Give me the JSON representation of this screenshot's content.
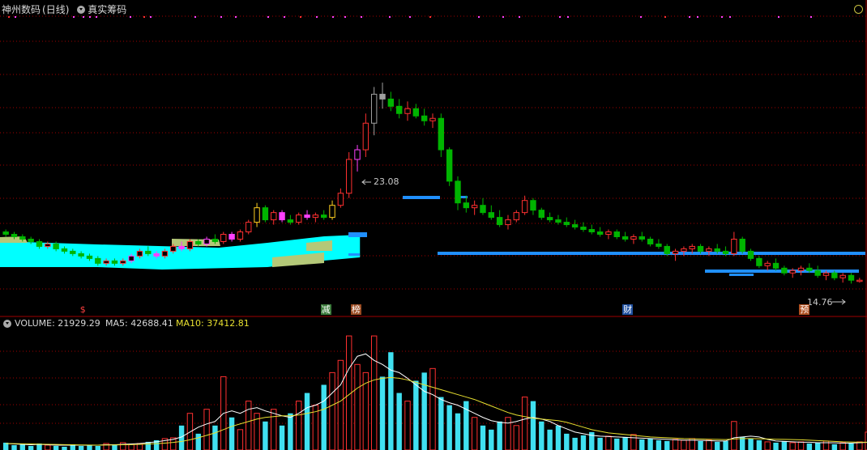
{
  "header": {
    "stock_name": "神州数码",
    "period": "(日线)",
    "indicator_name": "真实筹码"
  },
  "volume_panel": {
    "label": "VOLUME:",
    "volume_value": "21929.29",
    "ma5_label": "MA5:",
    "ma5_value": "42688.41",
    "ma10_label": "MA10:",
    "ma10_value": "37412.81"
  },
  "annotations": {
    "high_price": "23.08",
    "low_price": "14.76",
    "events": [
      {
        "text": "$",
        "color": "#ff4040",
        "bg": "#000000",
        "pos": 0.09
      },
      {
        "text": "减",
        "color": "#ffffff",
        "bg": "#3a7a3a",
        "pos": 0.37
      },
      {
        "text": "榜",
        "color": "#ffffff",
        "bg": "#9a4a20",
        "pos": 0.405
      },
      {
        "text": "财",
        "color": "#ffffff",
        "bg": "#2050a0",
        "pos": 0.72
      },
      {
        "text": "预",
        "color": "#ffffff",
        "bg": "#b05020",
        "pos": 0.925
      }
    ]
  },
  "colors": {
    "up": "#ff3030",
    "down": "#00b400",
    "cyan_band": "#00ffff",
    "khaki_band": "#b4c878",
    "blue_chips": "#2090ff",
    "magenta": "#ff40ff",
    "yellow_ma": "#e8e030",
    "white_ma": "#ffffff",
    "vol_down": "#40e0f0",
    "grid": "#a00000"
  },
  "chart_data": {
    "type": "candlestick",
    "title": "神州数码 (日线)",
    "ylim": [
      13.5,
      26.5
    ],
    "price_candles": [
      [
        16.9,
        17.0,
        16.7,
        16.8
      ],
      [
        16.8,
        16.9,
        16.6,
        16.7
      ],
      [
        16.7,
        16.8,
        16.5,
        16.6
      ],
      [
        16.6,
        16.7,
        16.4,
        16.5
      ],
      [
        16.5,
        16.6,
        16.2,
        16.3
      ],
      [
        16.3,
        16.5,
        16.2,
        16.4
      ],
      [
        16.4,
        16.5,
        16.1,
        16.2
      ],
      [
        16.2,
        16.3,
        16.0,
        16.1
      ],
      [
        16.1,
        16.2,
        15.9,
        16.0
      ],
      [
        16.0,
        16.1,
        15.8,
        15.9
      ],
      [
        15.9,
        16.0,
        15.7,
        15.8
      ],
      [
        15.8,
        15.9,
        15.5,
        15.6
      ],
      [
        15.6,
        15.8,
        15.5,
        15.7
      ],
      [
        15.7,
        15.8,
        15.5,
        15.6
      ],
      [
        15.6,
        15.8,
        15.5,
        15.7
      ],
      [
        15.7,
        16.0,
        15.6,
        15.9
      ],
      [
        15.9,
        16.2,
        15.8,
        16.1
      ],
      [
        16.1,
        16.3,
        15.9,
        16.0
      ],
      [
        16.0,
        16.1,
        15.8,
        15.9
      ],
      [
        15.9,
        16.2,
        15.8,
        16.1
      ],
      [
        16.1,
        16.4,
        16.0,
        16.3
      ],
      [
        16.3,
        16.5,
        16.1,
        16.2
      ],
      [
        16.2,
        16.6,
        16.1,
        16.5
      ],
      [
        16.5,
        16.6,
        16.3,
        16.4
      ],
      [
        16.4,
        16.7,
        16.3,
        16.6
      ],
      [
        16.6,
        16.8,
        16.4,
        16.5
      ],
      [
        16.5,
        16.9,
        16.4,
        16.8
      ],
      [
        16.8,
        16.9,
        16.5,
        16.6
      ],
      [
        16.6,
        17.0,
        16.5,
        16.9
      ],
      [
        16.9,
        17.4,
        16.8,
        17.3
      ],
      [
        17.3,
        18.1,
        17.1,
        17.9
      ],
      [
        17.9,
        18.0,
        17.3,
        17.4
      ],
      [
        17.4,
        17.8,
        17.2,
        17.7
      ],
      [
        17.7,
        17.8,
        17.3,
        17.4
      ],
      [
        17.4,
        17.6,
        17.2,
        17.3
      ],
      [
        17.3,
        17.7,
        17.2,
        17.6
      ],
      [
        17.6,
        17.8,
        17.4,
        17.5
      ],
      [
        17.5,
        17.7,
        17.3,
        17.6
      ],
      [
        17.6,
        17.8,
        17.4,
        17.5
      ],
      [
        17.5,
        18.2,
        17.4,
        18.0
      ],
      [
        18.0,
        18.7,
        17.9,
        18.5
      ],
      [
        18.5,
        20.2,
        18.3,
        19.9
      ],
      [
        19.9,
        20.5,
        19.4,
        20.3
      ],
      [
        20.3,
        21.8,
        20.0,
        21.4
      ],
      [
        21.4,
        22.9,
        20.9,
        22.6
      ],
      [
        22.6,
        23.08,
        22.0,
        22.4
      ],
      [
        22.4,
        22.7,
        21.9,
        22.1
      ],
      [
        22.1,
        22.4,
        21.6,
        21.8
      ],
      [
        21.8,
        22.3,
        21.5,
        22.0
      ],
      [
        22.0,
        22.2,
        21.6,
        21.7
      ],
      [
        21.7,
        22.0,
        21.3,
        21.5
      ],
      [
        21.5,
        21.8,
        21.2,
        21.6
      ],
      [
        21.6,
        21.8,
        20.0,
        20.3
      ],
      [
        20.3,
        20.4,
        18.8,
        19.0
      ],
      [
        19.0,
        19.2,
        17.8,
        18.1
      ],
      [
        18.1,
        18.4,
        17.7,
        17.9
      ],
      [
        17.9,
        18.2,
        17.6,
        18.0
      ],
      [
        18.0,
        18.3,
        17.6,
        17.7
      ],
      [
        17.7,
        18.0,
        17.4,
        17.5
      ],
      [
        17.5,
        17.8,
        17.1,
        17.2
      ],
      [
        17.2,
        17.6,
        17.0,
        17.4
      ],
      [
        17.4,
        17.8,
        17.3,
        17.7
      ],
      [
        17.7,
        18.4,
        17.6,
        18.2
      ],
      [
        18.2,
        18.3,
        17.6,
        17.8
      ],
      [
        17.8,
        17.9,
        17.4,
        17.5
      ],
      [
        17.5,
        17.7,
        17.3,
        17.4
      ],
      [
        17.4,
        17.6,
        17.2,
        17.3
      ],
      [
        17.3,
        17.5,
        17.1,
        17.2
      ],
      [
        17.2,
        17.4,
        17.0,
        17.1
      ],
      [
        17.1,
        17.3,
        16.9,
        17.0
      ],
      [
        17.0,
        17.2,
        16.8,
        16.9
      ],
      [
        16.9,
        17.1,
        16.7,
        16.8
      ],
      [
        16.8,
        17.0,
        16.6,
        16.9
      ],
      [
        16.9,
        17.0,
        16.6,
        16.7
      ],
      [
        16.7,
        16.9,
        16.5,
        16.6
      ],
      [
        16.6,
        16.8,
        16.4,
        16.7
      ],
      [
        16.7,
        16.9,
        16.5,
        16.6
      ],
      [
        16.6,
        16.7,
        16.3,
        16.4
      ],
      [
        16.4,
        16.6,
        16.2,
        16.3
      ],
      [
        16.3,
        16.4,
        15.9,
        16.0
      ],
      [
        16.0,
        16.2,
        15.7,
        16.1
      ],
      [
        16.1,
        16.3,
        15.9,
        16.2
      ],
      [
        16.2,
        16.4,
        16.0,
        16.3
      ],
      [
        16.3,
        16.4,
        16.0,
        16.1
      ],
      [
        16.1,
        16.3,
        15.9,
        16.2
      ],
      [
        16.2,
        16.4,
        16.0,
        16.1
      ],
      [
        16.1,
        16.3,
        15.9,
        16.0
      ],
      [
        16.0,
        16.9,
        15.9,
        16.6
      ],
      [
        16.6,
        16.7,
        16.0,
        16.1
      ],
      [
        16.1,
        16.2,
        15.7,
        15.8
      ],
      [
        15.8,
        15.9,
        15.4,
        15.5
      ],
      [
        15.5,
        15.7,
        15.3,
        15.6
      ],
      [
        15.6,
        15.8,
        15.3,
        15.4
      ],
      [
        15.4,
        15.5,
        15.1,
        15.2
      ],
      [
        15.2,
        15.4,
        15.0,
        15.3
      ],
      [
        15.3,
        15.5,
        15.1,
        15.4
      ],
      [
        15.4,
        15.6,
        15.2,
        15.3
      ],
      [
        15.3,
        15.5,
        15.0,
        15.1
      ],
      [
        15.1,
        15.3,
        14.9,
        15.2
      ],
      [
        15.2,
        15.3,
        14.9,
        15.0
      ],
      [
        15.0,
        15.2,
        14.8,
        15.1
      ],
      [
        15.1,
        15.2,
        14.76,
        14.9
      ],
      [
        14.9,
        15.0,
        14.8,
        14.9
      ]
    ],
    "volume": [
      9000,
      6000,
      7000,
      5000,
      8000,
      6000,
      5000,
      4000,
      7000,
      5000,
      6000,
      5000,
      8000,
      6000,
      9000,
      7000,
      8000,
      10000,
      12000,
      14000,
      15000,
      30000,
      45000,
      20000,
      50000,
      30000,
      90000,
      40000,
      25000,
      60000,
      45000,
      35000,
      50000,
      30000,
      45000,
      60000,
      70000,
      55000,
      80000,
      95000,
      110000,
      140000,
      105000,
      95000,
      140000,
      90000,
      120000,
      70000,
      60000,
      85000,
      95000,
      100000,
      65000,
      55000,
      45000,
      60000,
      40000,
      30000,
      25000,
      35000,
      40000,
      30000,
      65000,
      60000,
      35000,
      25000,
      30000,
      20000,
      15000,
      18000,
      22000,
      15000,
      17000,
      14000,
      16000,
      19000,
      13000,
      14000,
      12000,
      11000,
      13000,
      12000,
      14000,
      11000,
      12000,
      10000,
      11000,
      35000,
      16000,
      14000,
      12000,
      10000,
      9000,
      11000,
      9000,
      10000,
      8000,
      9000,
      11000,
      7000,
      9000,
      8000,
      10000,
      21929
    ],
    "ma5": [
      8000,
      7500,
      7000,
      6500,
      7000,
      6500,
      6000,
      6000,
      6000,
      6000,
      5800,
      6000,
      6500,
      6500,
      7000,
      7500,
      8000,
      9000,
      10000,
      11500,
      13000,
      16000,
      22000,
      28000,
      32000,
      35000,
      45000,
      48000,
      45000,
      50000,
      52000,
      48000,
      45000,
      42000,
      40000,
      45000,
      52000,
      55000,
      60000,
      70000,
      80000,
      100000,
      115000,
      118000,
      110000,
      105000,
      98000,
      95000,
      88000,
      80000,
      72000,
      68000,
      62000,
      58000,
      55000,
      50000,
      45000,
      40000,
      36000,
      34000,
      33000,
      35000,
      38000,
      40000,
      38000,
      35000,
      30000,
      26000,
      22000,
      20000,
      18000,
      17000,
      16500,
      16000,
      15500,
      15000,
      14500,
      14000,
      13500,
      13000,
      12500,
      12000,
      12000,
      11800,
      11500,
      11000,
      11000,
      15000,
      16000,
      17000,
      16000,
      13000,
      11000,
      10500,
      10000,
      9500,
      9500,
      9000,
      9000,
      8800,
      8500,
      8500,
      9000,
      9500
    ],
    "ma10": [
      8000,
      7800,
      7600,
      7400,
      7200,
      7000,
      6800,
      6600,
      6400,
      6200,
      6100,
      6000,
      6100,
      6200,
      6400,
      6600,
      6900,
      7300,
      7800,
      8500,
      9300,
      10500,
      12500,
      15000,
      18000,
      21000,
      25000,
      29000,
      32000,
      35000,
      38000,
      40000,
      41000,
      42000,
      42000,
      43000,
      45000,
      47000,
      50000,
      55000,
      60000,
      68000,
      76000,
      82000,
      86000,
      88000,
      89000,
      88000,
      86000,
      83000,
      80000,
      77000,
      74000,
      71000,
      68000,
      65000,
      62000,
      58000,
      54000,
      50000,
      46000,
      43000,
      41000,
      39000,
      38000,
      37000,
      36000,
      34000,
      31000,
      28000,
      25000,
      23000,
      21000,
      20000,
      19000,
      18000,
      17000,
      16000,
      15500,
      15000,
      14500,
      14000,
      13800,
      13500,
      13200,
      13000,
      12800,
      13500,
      14000,
      14000,
      13800,
      13500,
      13200,
      13000,
      12800,
      12500,
      12000,
      11500,
      11000,
      10500,
      10000,
      9800,
      9600,
      9500
    ],
    "y_volume_max": 150000
  }
}
